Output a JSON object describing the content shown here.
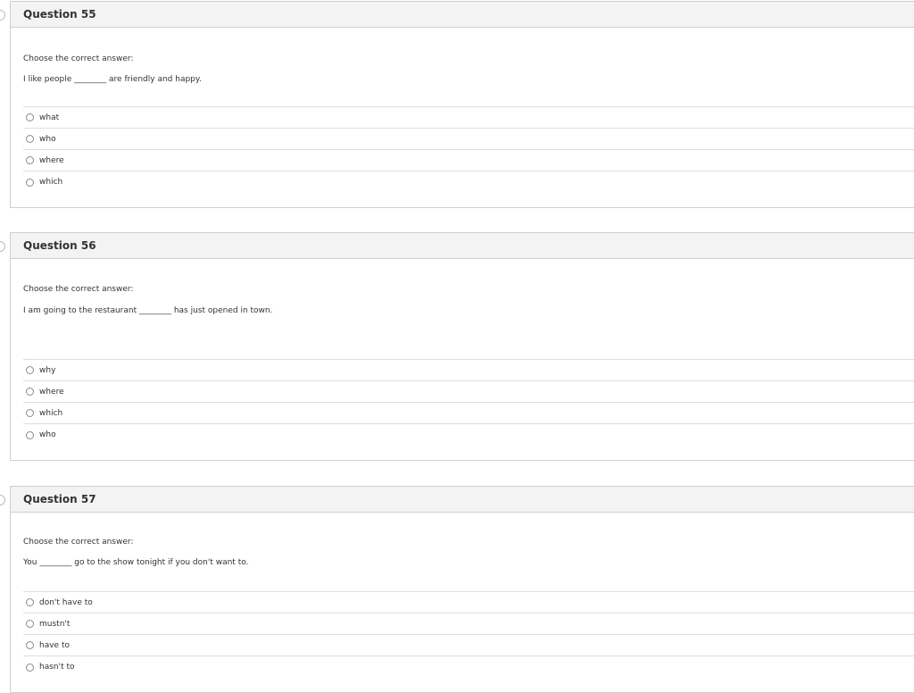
{
  "questions": [
    {
      "title": "Question 55",
      "instruction": "Choose the correct answer:",
      "prompt": "I like people ________ are friendly and happy.",
      "options": [
        "what",
        "who",
        "where",
        "which"
      ]
    },
    {
      "title": "Question 56",
      "instruction": "Choose the correct answer:",
      "prompt": "I am going to the restaurant ________ has just opened in town.",
      "options": [
        "why",
        "where",
        "which",
        "who"
      ]
    },
    {
      "title": "Question 57",
      "instruction": "Choose the correct answer:",
      "prompt": "You ________ go to the show tonight if you don't want to.",
      "options": [
        "don't have to",
        "mustn't",
        "have to",
        "hasn't to"
      ]
    }
  ]
}
